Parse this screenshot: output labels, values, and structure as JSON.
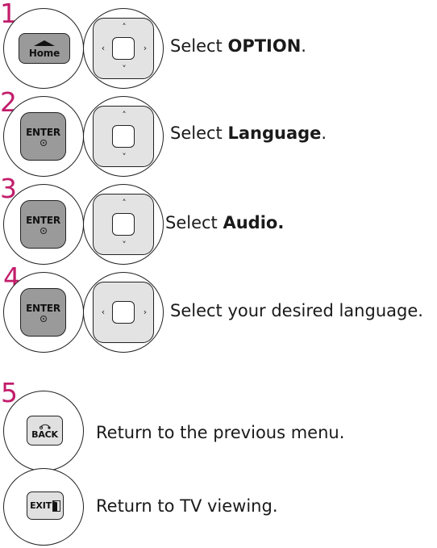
{
  "steps": [
    {
      "number": "1",
      "prefix": "Select ",
      "emphasis": "OPTION",
      "suffix": "."
    },
    {
      "number": "2",
      "prefix": "Select ",
      "emphasis": "Language",
      "suffix": "."
    },
    {
      "number": "3",
      "prefix": "Select ",
      "emphasis": "Audio.",
      "suffix": ""
    },
    {
      "number": "4",
      "prefix": "Select your desired language.",
      "emphasis": "",
      "suffix": ""
    },
    {
      "number": "5",
      "prefix": "Return to the previous menu.",
      "emphasis": "",
      "suffix": ""
    },
    {
      "number": "",
      "prefix": "Return to TV viewing.",
      "emphasis": "",
      "suffix": ""
    }
  ],
  "keys": {
    "home": "Home",
    "enter": "ENTER",
    "back": "BACK",
    "exit": "EXIT"
  },
  "icons": {
    "home": "home-roof-icon",
    "enter_dot": "enter-dot-icon",
    "back": "back-arrow-icon",
    "exit": "exit-door-icon",
    "arrows": [
      "chevron-up-icon",
      "chevron-down-icon",
      "chevron-left-icon",
      "chevron-right-icon"
    ]
  },
  "colors": {
    "step_number": "#c21d6b",
    "key_face": "#9a9a9a",
    "dpad_face": "#e3e3e3"
  }
}
